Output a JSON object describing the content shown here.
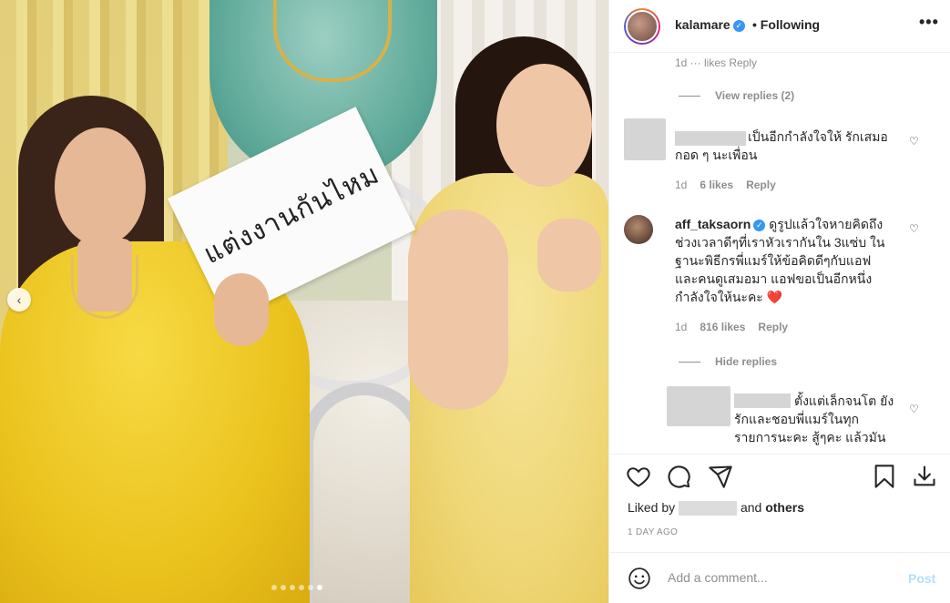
{
  "photo": {
    "sign_text": "แต่งงานกันไหม",
    "carousel_dots": 6,
    "active_dot": 6
  },
  "header": {
    "username": "kalamare",
    "verified_mark": "✓",
    "follow_status": "• Following",
    "more": "•••"
  },
  "comments": {
    "cut_line": "1d  ··· likes  Reply",
    "view_replies": "View replies (2)",
    "items": [
      {
        "text": "เป็นอีกกำลังใจให้ รักเสมอ กอด ๆ นะเพื่อน",
        "time": "1d",
        "likes": "6 likes",
        "reply": "Reply"
      },
      {
        "username": "aff_taksaorn",
        "text": "ดูรูปแล้วใจหายคิดถึงช่วงเวลาดีๆที่เราหัวเรากันใน 3แซ่บ ในฐานะพิธีกรพี่แมร์ให้ข้อคิดดีๆกับแอฟและคนดูเสมอมา แอฟขอเป็นอีกหนึ่งกำลังใจให้นะคะ",
        "heart_emoji": "❤️",
        "time": "1d",
        "likes": "816 likes",
        "reply": "Reply"
      }
    ],
    "hide_replies": "Hide replies",
    "reply_text": "ตั้งแต่เล็กจนโต ยังรักและชอบพี่แมร์ในทุกรายการนะคะ สู้ๆคะ แล้วมัน"
  },
  "actions": {
    "liked_prefix": "Liked by",
    "liked_suffix": "and",
    "others": "others",
    "time_ago": "1 DAY AGO"
  },
  "add_comment": {
    "placeholder": "Add a comment...",
    "post": "Post"
  },
  "icons": [
    "heart-icon",
    "comment-icon",
    "share-icon",
    "bookmark-icon",
    "download-icon",
    "emoji-icon",
    "verified-icon",
    "more-icon"
  ],
  "colors": {
    "accent": "#3897f0",
    "post_disabled": "#b2dffc",
    "muted": "#8e8e8e",
    "heart": "#ed4956"
  }
}
